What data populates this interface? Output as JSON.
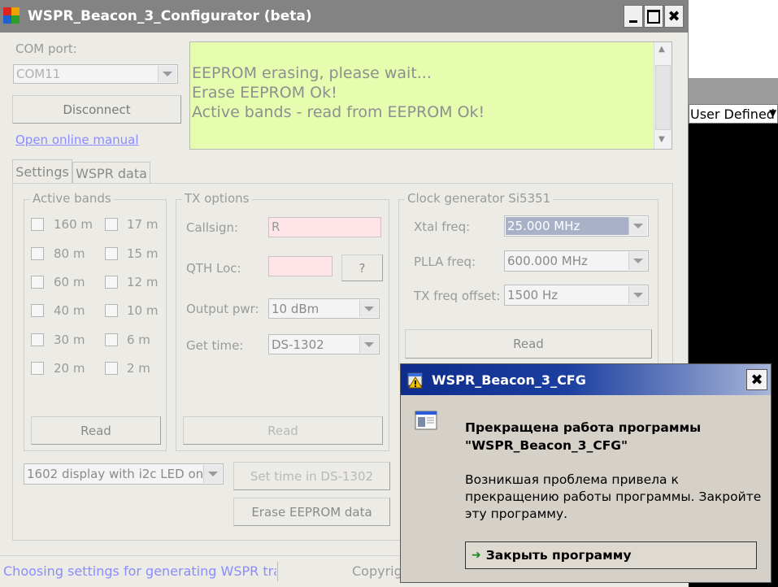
{
  "main_window": {
    "title": "WSPR_Beacon_3_Configurator (beta)",
    "com_port_label": "COM port:",
    "com_port_value": "COM11",
    "disconnect_button": "Disconnect",
    "online_manual_link": "Open online manual",
    "log_lines": [
      "EEPROM erasing, please wait...",
      "Erase EEPROM Ok!",
      "Active bands - read from EEPROM Ok!"
    ],
    "tabs": [
      {
        "label": "Settings"
      },
      {
        "label": "WSPR data"
      }
    ],
    "active_bands": {
      "title": "Active bands",
      "left": [
        "160 m",
        "80 m",
        "60 m",
        "40 m",
        "30 m",
        "20 m"
      ],
      "right": [
        "17 m",
        "15 m",
        "12 m",
        "10 m",
        "6 m",
        "2 m"
      ],
      "read_button": "Read"
    },
    "tx_options": {
      "title": "TX options",
      "callsign_label": "Callsign:",
      "callsign_value": "R",
      "qth_label": "QTH Loc:",
      "qth_value": "",
      "qth_help_button": "?",
      "output_pwr_label": "Output pwr:",
      "output_pwr_value": "10 dBm",
      "get_time_label": "Get time:",
      "get_time_value": "DS-1302",
      "read_button": "Read"
    },
    "clock_gen": {
      "title": "Clock generator Si5351",
      "xtal_label": "Xtal freq:",
      "xtal_value": "25.000 MHz",
      "plla_label": "PLLA freq:",
      "plla_value": "600.000 MHz",
      "offset_label": "TX freq offset:",
      "offset_value": "1500 Hz",
      "read_button": "Read"
    },
    "display_select": "1602 display with i2c LED on",
    "set_time_button": "Set time in DS-1302",
    "erase_button": "Erase EEPROM data",
    "status_text": "Choosing settings for generating WSPR transı",
    "copyright_text": "Copyrigl"
  },
  "background_window": {
    "dropdown_value": "User Defined"
  },
  "crash_dialog": {
    "title": "WSPR_Beacon_3_CFG",
    "heading_line1": "Прекращена работа программы",
    "heading_line2": "\"WSPR_Beacon_3_CFG\"",
    "body_line1": "Возникшая проблема привела к",
    "body_line2": "прекращению работы программы. Закройте",
    "body_line3": "эту программу.",
    "close_button": "Закрыть программу"
  },
  "colors": {
    "titlebar": "#838383",
    "window_bg": "#ecebe6",
    "log_bg": "#e6fcae",
    "callsign_bg": "#ffe4e8",
    "xtal_selected": "#a9b1c8",
    "dialog_title_start": "#0d2c8b",
    "dialog_title_end": "#a8b5d8",
    "dialog_bg": "#d5d1c8"
  }
}
